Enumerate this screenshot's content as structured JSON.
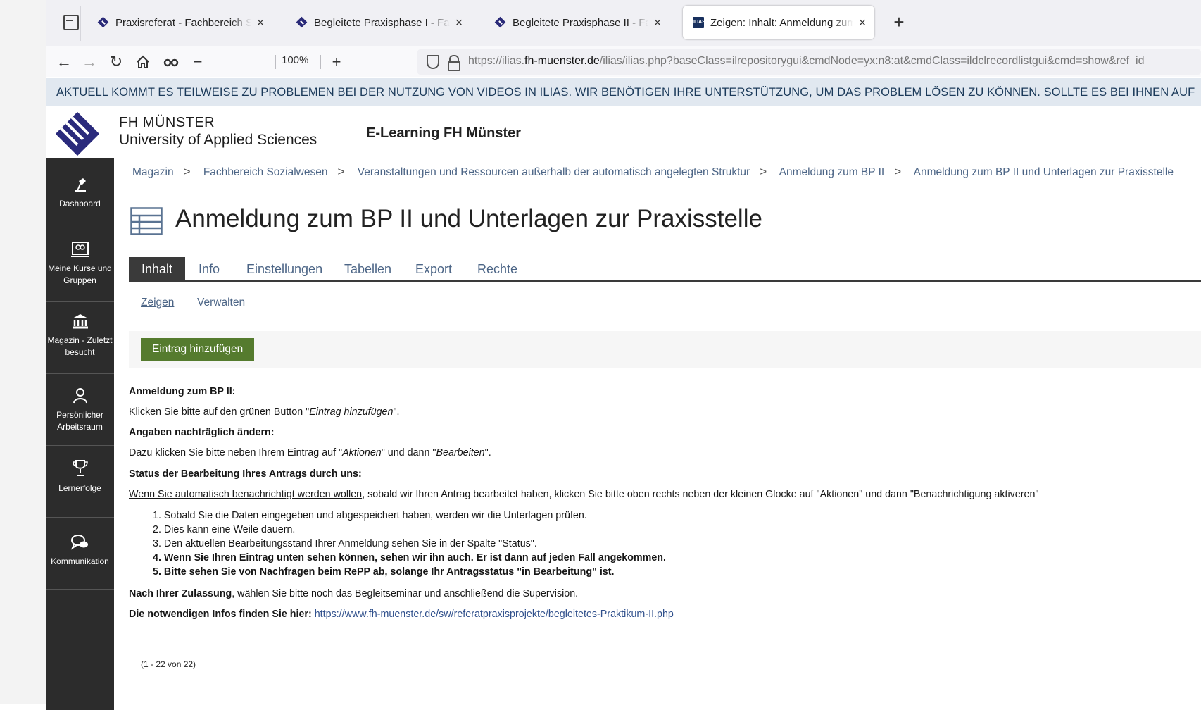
{
  "browser": {
    "tabs": [
      {
        "title": "Praxisreferat - Fachbereich Sozialwesen",
        "icon": "diamond-favicon"
      },
      {
        "title": "Begleitete Praxisphase I - Fachbereich",
        "icon": "diamond-favicon"
      },
      {
        "title": "Begleitete Praxisphase II - Fachbereich",
        "icon": "diamond-favicon"
      },
      {
        "title": "Zeigen: Inhalt: Anmeldung zum BP II",
        "icon": "ilias-favicon",
        "active": true
      }
    ],
    "ilias_favicon_text": "ILIAS",
    "zoom": "100%",
    "url_pre": "https://ilias.",
    "url_host": "fh-muenster.de",
    "url_post": "/ilias/ilias.php?baseClass=ilrepositorygui&cmdNode=yx:n8:at&cmdClass=ildclrecordlistgui&cmd=show&ref_id"
  },
  "announcement": "AKTUELL KOMMT ES TEILWEISE ZU PROBLEMEN BEI DER NUTZUNG VON VIDEOS IN ILIAS. WIR BENÖTIGEN IHRE UNTERSTÜTZUNG, UM DAS PROBLEM LÖSEN ZU KÖNNEN. SOLLTE ES BEI IHNEN AUF",
  "header": {
    "org_line1": "FH MÜNSTER",
    "org_line2": "University of Applied Sciences",
    "site_title": "E-Learning FH Münster"
  },
  "sidebar": {
    "items": [
      {
        "label": "Dashboard",
        "icon": "dashboard-icon"
      },
      {
        "label": "Meine Kurse und Gruppen",
        "icon": "courses-icon"
      },
      {
        "label": "Magazin - Zuletzt besucht",
        "icon": "repository-icon"
      },
      {
        "label": "Persönlicher Arbeitsraum",
        "icon": "person-icon"
      },
      {
        "label": "Lernerfolge",
        "icon": "trophy-icon"
      },
      {
        "label": "Kommunikation",
        "icon": "chat-icon"
      }
    ]
  },
  "breadcrumb": [
    "Magazin",
    "Fachbereich Sozialwesen",
    "Veranstaltungen und Ressourcen außerhalb der automatisch angelegten Struktur",
    "Anmeldung zum BP II",
    "Anmeldung zum BP II und Unterlagen zur Praxisstelle"
  ],
  "page_title": "Anmeldung zum BP II und Unterlagen zur Praxisstelle",
  "tabs": [
    "Inhalt",
    "Info",
    "Einstellungen",
    "Tabellen",
    "Export",
    "Rechte"
  ],
  "subtabs": [
    "Zeigen",
    "Verwalten"
  ],
  "add_button": "Eintrag hinzufügen",
  "content": {
    "h1": "Anmeldung zum BP II:",
    "p1_pre": "Klicken Sie bitte auf den grünen Button \"",
    "p1_em": "Eintrag hinzufügen",
    "p1_post": "\".",
    "h2": "Angaben nachträglich ändern:",
    "p2_pre": "Dazu klicken Sie bitte neben Ihrem Eintrag auf \"",
    "p2_em1": "Aktionen",
    "p2_mid": "\" und dann \"",
    "p2_em2": "Bearbeiten",
    "p2_post": "\".",
    "h3": "Status der Bearbeitung Ihres Antrags durch uns:",
    "p3_link": "Wenn Sie automatisch benachrichtigt werden wollen",
    "p3_rest": ", sobald wir Ihren Antrag bearbeitet haben, klicken Sie bitte oben rechts neben der kleinen Glocke auf \"Aktionen\" und dann \"Benachrichtigung aktiveren\"",
    "list": [
      "1. Sobald Sie die Daten eingegeben und abgespeichert haben, werden wir die Unterlagen prüfen.",
      "2. Dies kann eine Weile dauern.",
      "3. Den aktuellen Bearbeitungsstand Ihrer Anmeldung sehen Sie in der Spalte \"Status\".",
      "4. Wenn Sie Ihren Eintrag unten sehen können, sehen wir ihn auch. Er ist dann auf jeden Fall angekommen.",
      "5. Bitte sehen Sie von Nachfragen beim RePP ab, solange Ihr Antragsstatus \"in Bearbeitung\" ist."
    ],
    "p4_bold": "Nach Ihrer Zulassung",
    "p4_rest": ", wählen Sie bitte noch das Begleitseminar und anschließend die Supervision.",
    "p5_bold": "Die notwendigen Infos finden Sie hier: ",
    "p5_link": "https://www.fh-muenster.de/sw/referatpraxisprojekte/begleitetes-Praktikum-II.php"
  },
  "count": "(1 - 22 von 22)",
  "colors": {
    "green": "#557b2e",
    "link": "#4c6586",
    "sidebar": "#2c2c2c",
    "announce_bg": "#e1e8f0"
  }
}
